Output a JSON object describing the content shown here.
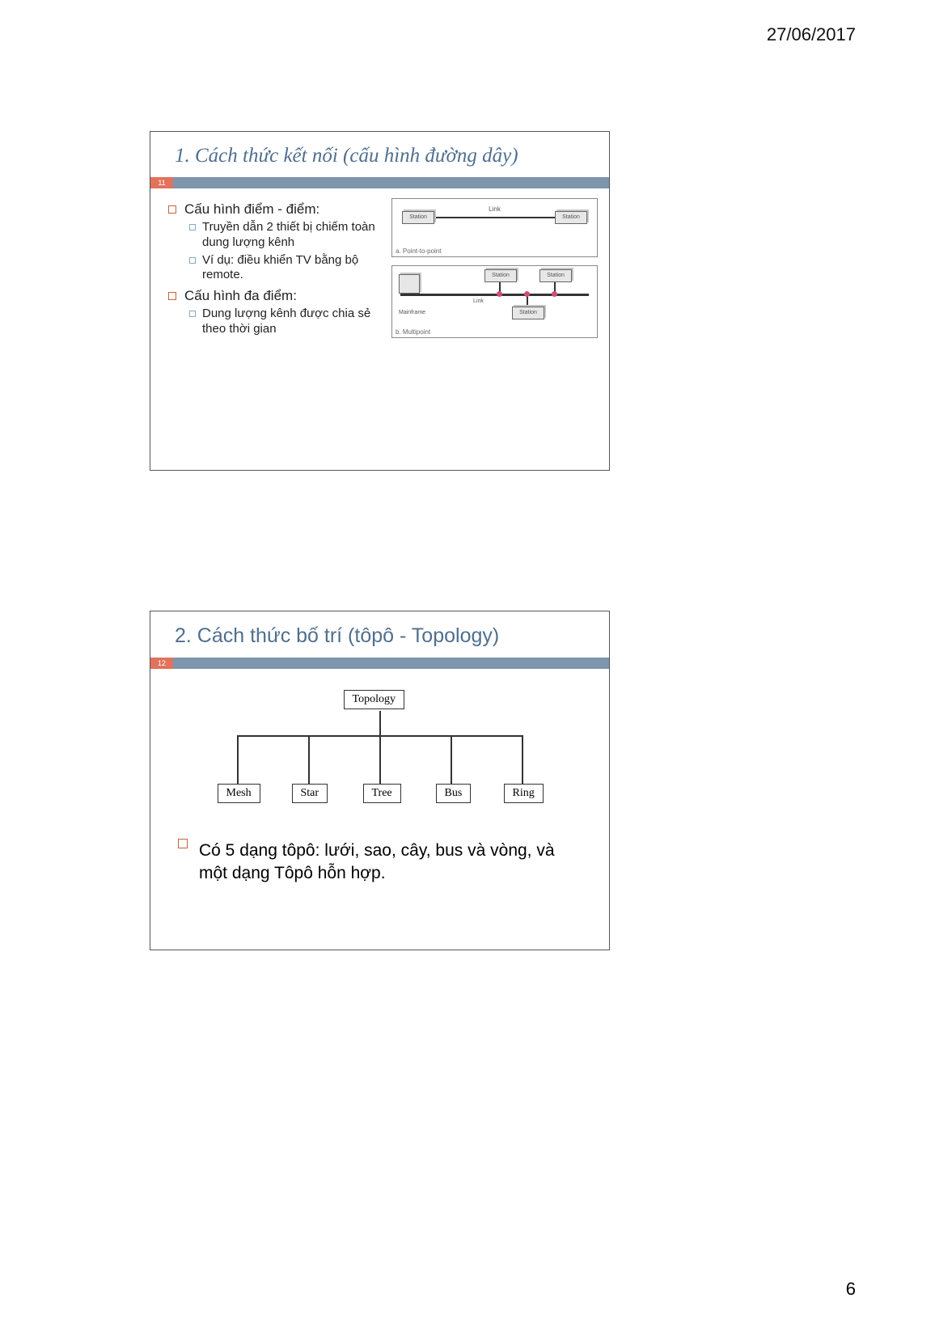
{
  "header": {
    "date": "27/06/2017",
    "page_number": "6"
  },
  "slide1": {
    "number": "11",
    "title": "1. Cách thức kết nối (cấu hình đường dây)",
    "bullets": {
      "p2p_heading": "Cấu hình điểm - điểm:",
      "p2p_items": [
        "Truyền dẫn 2 thiết bị chiếm toàn dung lượng kênh",
        "Ví dụ: điều khiển TV bằng bộ remote."
      ],
      "mp_heading": "Cấu hình đa điểm:",
      "mp_items": [
        "Dung lượng kênh được chia sẻ theo thời gian"
      ]
    },
    "diagram": {
      "link_label": "Link",
      "station_label": "Station",
      "mainframe_label": "Mainframe",
      "caption_a": "a. Point-to-point",
      "caption_b": "b. Multipoint"
    }
  },
  "slide2": {
    "number": "12",
    "title": "2. Cách thức bố trí (tôpô - Topology)",
    "tree": {
      "root": "Topology",
      "leaves": [
        "Mesh",
        "Star",
        "Tree",
        "Bus",
        "Ring"
      ]
    },
    "summary": "Có 5 dạng tôpô: lưới, sao, cây, bus và vòng, và một dạng Tôpô hỗn hợp."
  }
}
